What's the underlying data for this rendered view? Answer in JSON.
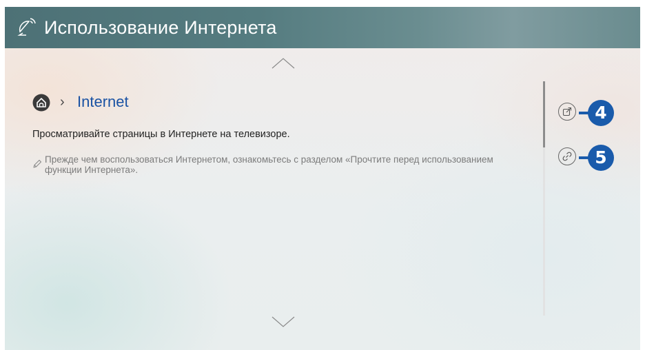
{
  "header": {
    "title": "Использование Интернета",
    "icon": "satellite-dish-icon",
    "color": "#557c80"
  },
  "breadcrumb": {
    "home_icon": "home-icon",
    "separator": "›",
    "label": "Internet"
  },
  "content": {
    "description": "Просматривайте страницы в Интернете на телевизоре.",
    "note": "Прежде чем воспользоваться Интернетом, ознакомьтесь с разделом «Прочтите перед использованием функции Интернета».",
    "note_icon": "pencil-icon"
  },
  "side_buttons": [
    {
      "icon": "share-icon",
      "callout": "4"
    },
    {
      "icon": "link-icon",
      "callout": "5"
    }
  ],
  "colors": {
    "accent": "#1a5bab",
    "link": "#1a52a3"
  }
}
